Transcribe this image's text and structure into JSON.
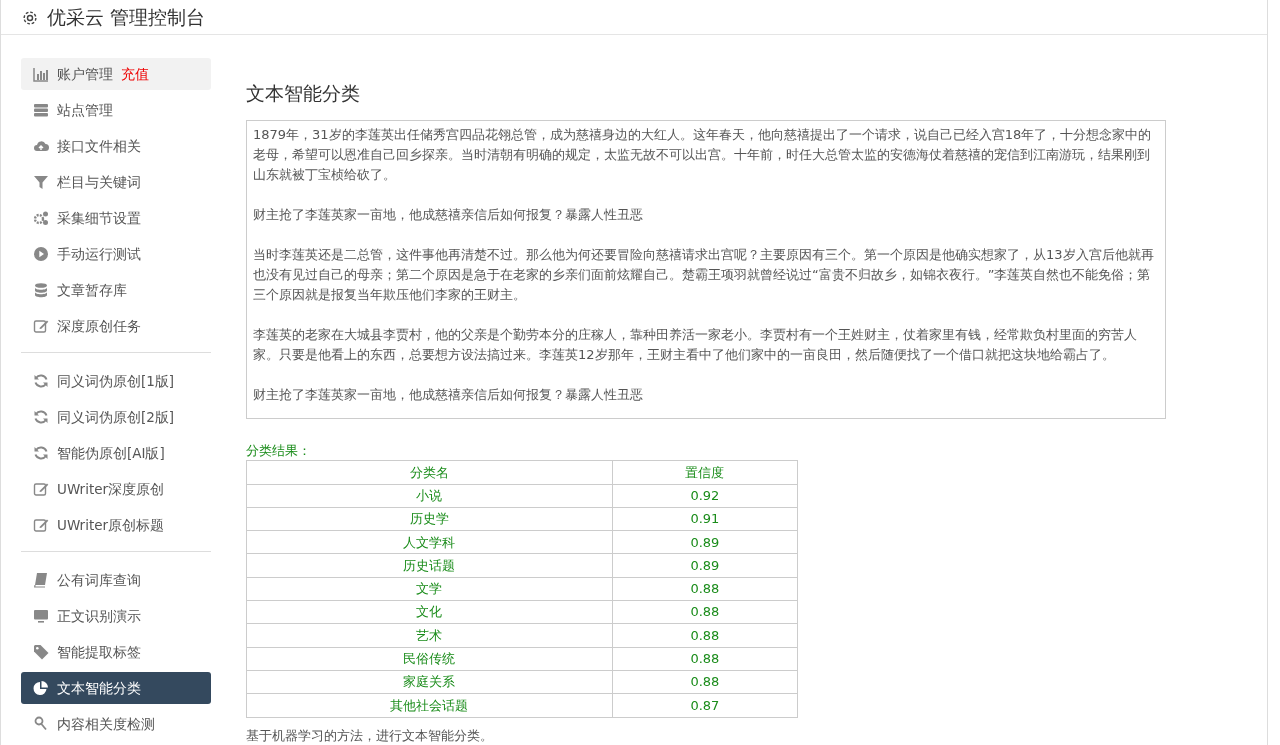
{
  "header": {
    "title": "优采云 管理控制台"
  },
  "sidebar": {
    "groups": [
      {
        "items": [
          {
            "label": "账户管理",
            "tag": "充值",
            "highlighted": true,
            "selected": false
          },
          {
            "label": "站点管理",
            "highlighted": false,
            "selected": false
          },
          {
            "label": "接口文件相关",
            "highlighted": false,
            "selected": false
          },
          {
            "label": "栏目与关键词",
            "highlighted": false,
            "selected": false
          },
          {
            "label": "采集细节设置",
            "highlighted": false,
            "selected": false
          },
          {
            "label": "手动运行测试",
            "highlighted": false,
            "selected": false
          },
          {
            "label": "文章暂存库",
            "highlighted": false,
            "selected": false
          },
          {
            "label": "深度原创任务",
            "highlighted": false,
            "selected": false
          }
        ]
      },
      {
        "items": [
          {
            "label": "同义词伪原创[1版]",
            "highlighted": false,
            "selected": false
          },
          {
            "label": "同义词伪原创[2版]",
            "highlighted": false,
            "selected": false
          },
          {
            "label": "智能伪原创[AI版]",
            "highlighted": false,
            "selected": false
          },
          {
            "label": "UWriter深度原创",
            "highlighted": false,
            "selected": false
          },
          {
            "label": "UWriter原创标题",
            "highlighted": false,
            "selected": false
          }
        ]
      },
      {
        "items": [
          {
            "label": "公有词库查询",
            "highlighted": false,
            "selected": false
          },
          {
            "label": "正文识别演示",
            "highlighted": false,
            "selected": false
          },
          {
            "label": "智能提取标签",
            "highlighted": false,
            "selected": false
          },
          {
            "label": "文本智能分类",
            "highlighted": false,
            "selected": true
          },
          {
            "label": "内容相关度检测",
            "highlighted": false,
            "selected": false
          }
        ]
      }
    ]
  },
  "main": {
    "title": "文本智能分类",
    "input_paragraphs": [
      "1879年，31岁的李莲英出任储秀宫四品花翎总管，成为慈禧身边的大红人。这年春天，他向慈禧提出了一个请求，说自己已经入宫18年了，十分想念家中的老母，希望可以恩准自己回乡探亲。当时清朝有明确的规定，太监无故不可以出宫。十年前，时任大总管太监的安德海仗着慈禧的宠信到江南游玩，结果刚到山东就被丁宝桢给砍了。",
      "财主抢了李莲英家一亩地，他成慈禧亲信后如何报复？暴露人性丑恶",
      "当时李莲英还是二总管，这件事他再清楚不过。那么他为何还要冒险向慈禧请求出宫呢？主要原因有三个。第一个原因是他确实想家了，从13岁入宫后他就再也没有见过自己的母亲；第二个原因是急于在老家的乡亲们面前炫耀自己。楚霸王项羽就曾经说过“富贵不归故乡，如锦衣夜行。”李莲英自然也不能免俗；第三个原因就是报复当年欺压他们李家的王财主。",
      "李莲英的老家在大城县李贾村，他的父亲是个勤劳本分的庄稼人，靠种田养活一家老小。李贾村有一个王姓财主，仗着家里有钱，经常欺负村里面的穷苦人家。只要是他看上的东西，总要想方设法搞过来。李莲英12岁那年，王财主看中了他们家中的一亩良田，然后随便找了一个借口就把这块地给霸占了。",
      "财主抢了李莲英家一亩地，他成慈禧亲信后如何报复？暴露人性丑恶"
    ],
    "result_label": "分类结果：",
    "table": {
      "columns": [
        "分类名",
        "置信度"
      ],
      "rows": [
        [
          "小说",
          "0.92"
        ],
        [
          "历史学",
          "0.91"
        ],
        [
          "人文学科",
          "0.89"
        ],
        [
          "历史话题",
          "0.89"
        ],
        [
          "文学",
          "0.88"
        ],
        [
          "文化",
          "0.88"
        ],
        [
          "艺术",
          "0.88"
        ],
        [
          "民俗传统",
          "0.88"
        ],
        [
          "家庭关系",
          "0.88"
        ],
        [
          "其他社会话题",
          "0.87"
        ]
      ]
    },
    "note": "基于机器学习的方法，进行文本智能分类。"
  }
}
